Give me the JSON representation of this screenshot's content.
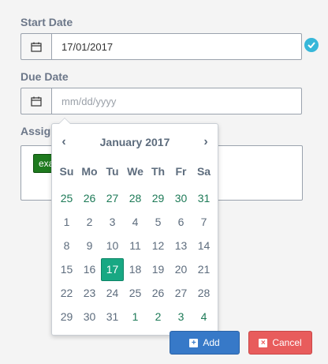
{
  "start_date": {
    "label": "Start Date",
    "value": "17/01/2017",
    "valid_color": "#37b7d9"
  },
  "due_date": {
    "label": "Due Date",
    "placeholder": "mm/dd/yyyy"
  },
  "assign": {
    "label": "Assign",
    "tag": "exa"
  },
  "datepicker": {
    "month_label": "January 2017",
    "prev": "‹",
    "next": "›",
    "weekdays": [
      "Su",
      "Mo",
      "Tu",
      "We",
      "Th",
      "Fr",
      "Sa"
    ],
    "weeks": [
      [
        "25",
        "26",
        "27",
        "28",
        "29",
        "30",
        "31"
      ],
      [
        "1",
        "2",
        "3",
        "4",
        "5",
        "6",
        "7"
      ],
      [
        "8",
        "9",
        "10",
        "11",
        "12",
        "13",
        "14"
      ],
      [
        "15",
        "16",
        "17",
        "18",
        "19",
        "20",
        "21"
      ],
      [
        "22",
        "23",
        "24",
        "25",
        "26",
        "27",
        "28"
      ],
      [
        "29",
        "30",
        "31",
        "1",
        "2",
        "3",
        "4"
      ]
    ],
    "other_month_flags": [
      [
        true,
        true,
        true,
        true,
        true,
        true,
        true
      ],
      [
        false,
        false,
        false,
        false,
        false,
        false,
        false
      ],
      [
        false,
        false,
        false,
        false,
        false,
        false,
        false
      ],
      [
        false,
        false,
        false,
        false,
        false,
        false,
        false
      ],
      [
        false,
        false,
        false,
        false,
        false,
        false,
        false
      ],
      [
        false,
        false,
        false,
        true,
        true,
        true,
        true
      ]
    ],
    "selected": "17",
    "accent": "#18a883"
  },
  "buttons": {
    "add": "Add",
    "add_icon": "plus-square-icon",
    "cancel": "Cancel",
    "cancel_icon": "close-square-icon"
  }
}
